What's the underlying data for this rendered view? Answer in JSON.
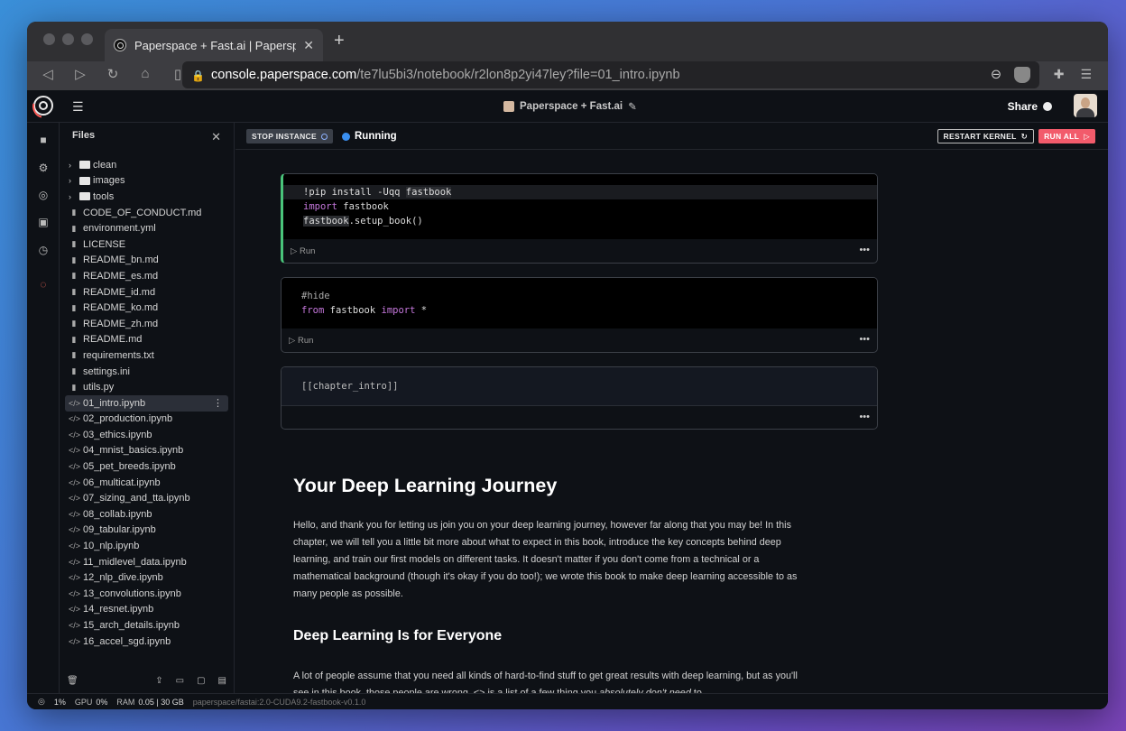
{
  "browser": {
    "tab_title": "Paperspace + Fast.ai | Paperspa",
    "url_host": "console.paperspace.com",
    "url_path": "/te7lu5bi3/notebook/r2lon8p2yi47ley?file=01_intro.ipynb"
  },
  "header": {
    "notebook_title": "Paperspace + Fast.ai",
    "share_label": "Share"
  },
  "sidebar": {
    "title": "Files",
    "items": [
      {
        "name": "clean",
        "type": "folder"
      },
      {
        "name": "images",
        "type": "folder"
      },
      {
        "name": "tools",
        "type": "folder"
      },
      {
        "name": "CODE_OF_CONDUCT.md",
        "type": "file"
      },
      {
        "name": "environment.yml",
        "type": "file"
      },
      {
        "name": "LICENSE",
        "type": "file"
      },
      {
        "name": "README_bn.md",
        "type": "file"
      },
      {
        "name": "README_es.md",
        "type": "file"
      },
      {
        "name": "README_id.md",
        "type": "file"
      },
      {
        "name": "README_ko.md",
        "type": "file"
      },
      {
        "name": "README_zh.md",
        "type": "file"
      },
      {
        "name": "README.md",
        "type": "file"
      },
      {
        "name": "requirements.txt",
        "type": "file"
      },
      {
        "name": "settings.ini",
        "type": "file"
      },
      {
        "name": "utils.py",
        "type": "file"
      },
      {
        "name": "01_intro.ipynb",
        "type": "notebook",
        "selected": true
      },
      {
        "name": "02_production.ipynb",
        "type": "notebook"
      },
      {
        "name": "03_ethics.ipynb",
        "type": "notebook"
      },
      {
        "name": "04_mnist_basics.ipynb",
        "type": "notebook"
      },
      {
        "name": "05_pet_breeds.ipynb",
        "type": "notebook"
      },
      {
        "name": "06_multicat.ipynb",
        "type": "notebook"
      },
      {
        "name": "07_sizing_and_tta.ipynb",
        "type": "notebook"
      },
      {
        "name": "08_collab.ipynb",
        "type": "notebook"
      },
      {
        "name": "09_tabular.ipynb",
        "type": "notebook"
      },
      {
        "name": "10_nlp.ipynb",
        "type": "notebook"
      },
      {
        "name": "11_midlevel_data.ipynb",
        "type": "notebook"
      },
      {
        "name": "12_nlp_dive.ipynb",
        "type": "notebook"
      },
      {
        "name": "13_convolutions.ipynb",
        "type": "notebook"
      },
      {
        "name": "14_resnet.ipynb",
        "type": "notebook"
      },
      {
        "name": "15_arch_details.ipynb",
        "type": "notebook"
      },
      {
        "name": "16_accel_sgd.ipynb",
        "type": "notebook"
      }
    ]
  },
  "toolbar": {
    "stop_label": "STOP INSTANCE",
    "status_text": "Running",
    "restart_label": "RESTART KERNEL",
    "run_all_label": "RUN ALL"
  },
  "cells": {
    "run_label": "Run"
  },
  "content": {
    "h1": "Your Deep Learning Journey",
    "p1": "Hello, and thank you for letting us join you on your deep learning journey, however far along that you may be! In this chapter, we will tell you a little bit more about what to expect in this book, introduce the key concepts behind deep learning, and train our first models on different tasks. It doesn't matter if you don't come from a technical or a mathematical background (though it's okay if you do too!); we wrote this book to make deep learning accessible to as many people as possible.",
    "h2": "Deep Learning Is for Everyone",
    "p2_a": "A lot of people assume that you need all kinds of hard-to-find stuff to get great results with deep learning, but as you'll see in this book, those people are wrong. <> is a list of a few thing you ",
    "p2_em": "absolutely don't need",
    "p2_b": " to"
  },
  "statusbar": {
    "cpu": "1%",
    "gpu_label": "GPU",
    "gpu": "0%",
    "ram_label": "RAM",
    "ram": "0.05 | 30 GB",
    "image": "paperspace/fastai:2.0-CUDA9.2-fastbook-v0.1.0"
  },
  "colors": {
    "accent_run_all": "#f25b6b",
    "status_running": "#3a8ff0",
    "active_cell": "#49c47a"
  }
}
